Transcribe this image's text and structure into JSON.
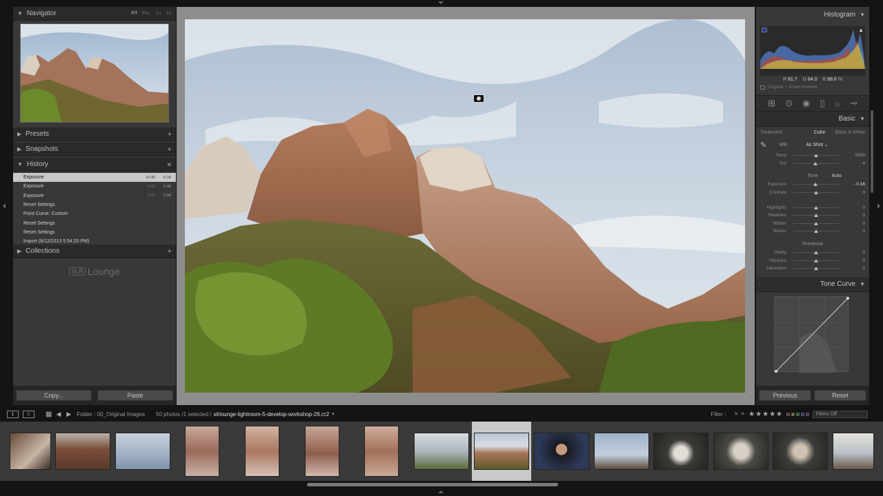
{
  "navigator": {
    "title": "Navigator",
    "modes": [
      "FIT",
      "FILL",
      "1:1",
      "3:1"
    ]
  },
  "panels": {
    "presets": "Presets",
    "snapshots": "Snapshots",
    "history": "History",
    "collections": "Collections"
  },
  "history": [
    {
      "label": "Exposure",
      "v1": "+0.30",
      "v2": "-0.16",
      "selected": true
    },
    {
      "label": "Exposure",
      "v1": "-0.62",
      "v2": "0.46",
      "selected": false
    },
    {
      "label": "Exposure",
      "v1": "0.04",
      "v2": "0.04",
      "selected": false
    },
    {
      "label": "Reset Settings",
      "v1": "",
      "v2": "",
      "selected": false
    },
    {
      "label": "Point Curve: Custom",
      "v1": "",
      "v2": "",
      "selected": false
    },
    {
      "label": "Reset Settings",
      "v1": "",
      "v2": "",
      "selected": false
    },
    {
      "label": "Reset Settings",
      "v1": "",
      "v2": "",
      "selected": false
    },
    {
      "label": "Import (8/12/2013 5:54:20 PM)",
      "v1": "",
      "v2": "",
      "selected": false
    }
  ],
  "logo": {
    "slr": "SLR",
    "word": "Lounge"
  },
  "left_buttons": {
    "copy": "Copy...",
    "paste": "Paste"
  },
  "right_buttons": {
    "previous": "Previous",
    "reset": "Reset"
  },
  "histogram": {
    "title": "Histogram",
    "r_label": "R",
    "r": "81.7",
    "g_label": "G",
    "g": "84.0",
    "b_label": "B",
    "b": "88.6",
    "pct": "%",
    "preview": "Original + Smart Preview"
  },
  "basic": {
    "title": "Basic",
    "treatment_label": "Treatment :",
    "treatment_color": "Color",
    "treatment_bw": "Black & White",
    "wb_label": "WB :",
    "wb_value": "As Shot",
    "tone_label": "Tone",
    "auto": "Auto",
    "presence_label": "Presence",
    "wb_sliders": [
      {
        "label": "Temp",
        "value": "5950",
        "pos": 0.5
      },
      {
        "label": "Tint",
        "value": "- 4",
        "pos": 0.48
      }
    ],
    "tone_sliders": [
      {
        "label": "Exposure",
        "value": "- 0.16",
        "pos": 0.49,
        "hi": true
      },
      {
        "label": "Contrast",
        "value": "0",
        "pos": 0.5,
        "hi": false
      }
    ],
    "tone2_sliders": [
      {
        "label": "Highlights",
        "value": "0",
        "pos": 0.5
      },
      {
        "label": "Shadows",
        "value": "0",
        "pos": 0.5
      },
      {
        "label": "Whites",
        "value": "0",
        "pos": 0.5
      },
      {
        "label": "Blacks",
        "value": "0",
        "pos": 0.5
      }
    ],
    "presence_sliders": [
      {
        "label": "Clarity",
        "value": "0",
        "pos": 0.5
      },
      {
        "label": "Vibrance",
        "value": "0",
        "pos": 0.5
      },
      {
        "label": "Saturation",
        "value": "0",
        "pos": 0.5
      }
    ]
  },
  "tone_curve": {
    "title": "Tone Curve"
  },
  "filmstrip_bar": {
    "mon1": "1",
    "mon2": "2",
    "folder": "Folder : 00_Original Images",
    "count": "50 photos /1 selected /",
    "filename": "slrlounge-lightroom-5-develop-workshop-26.cr2",
    "filter_label": "Filter :",
    "stars": "★★★★★",
    "filters_off": "Filters Off"
  },
  "colors": {
    "accent_selected": "#c9c9c9",
    "panel_bg": "#383838"
  }
}
